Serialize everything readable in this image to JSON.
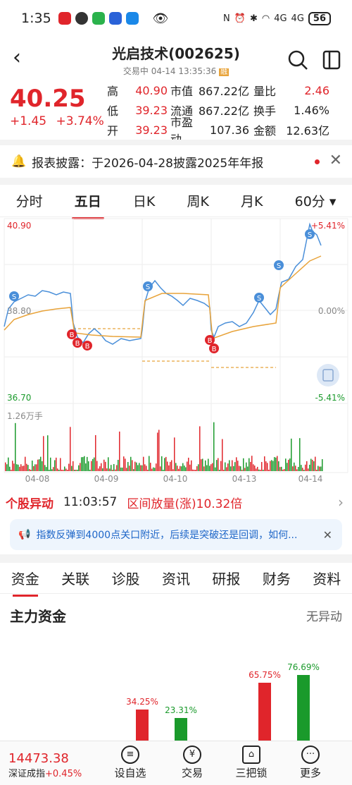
{
  "status": {
    "time": "1:35",
    "battery": "56",
    "net1": "4G",
    "net2": "4G"
  },
  "header": {
    "title": "光启技术(002625)",
    "subtitle": "交易中 04-14 13:35:36",
    "badge": "融"
  },
  "quote": {
    "price": "40.25",
    "change": "+1.45",
    "change_pct": "+3.74%",
    "rows": [
      {
        "l1": "高",
        "v1": "40.90",
        "l2": "市值",
        "v2": "867.22亿",
        "l3": "量比",
        "v3": "2.46"
      },
      {
        "l1": "低",
        "v1": "39.23",
        "l2": "流通",
        "v2": "867.22亿",
        "l3": "换手",
        "v3": "1.46%"
      },
      {
        "l1": "开",
        "v1": "39.23",
        "l2": "市盈动",
        "v2": "107.36",
        "l3": "金额",
        "v3": "12.63亿"
      }
    ]
  },
  "notice": {
    "text": "报表披露：于2026-04-28披露2025年年报"
  },
  "period_tabs": [
    "分时",
    "五日",
    "日K",
    "周K",
    "月K",
    "60分"
  ],
  "chart_labels": {
    "top_left": "40.90",
    "mid_left": "38.80",
    "bottom_left": "36.70",
    "top_right": "+5.41%",
    "mid_right": "0.00%",
    "bottom_right": "-5.41%",
    "volume": "1.26万手",
    "dates": [
      "04-08",
      "04-09",
      "04-10",
      "04-13",
      "04-14"
    ]
  },
  "alert": {
    "label": "个股异动",
    "time": "11:03:57",
    "text": "区间放量(涨)10.32倍"
  },
  "news": {
    "text": "指数反弹到4000点关口附近，后续是突破还是回调，如何..."
  },
  "bottom_tabs": [
    "资金",
    "关联",
    "诊股",
    "资讯",
    "研报",
    "财务",
    "资料"
  ],
  "section": {
    "title": "主力资金",
    "right": "无异动"
  },
  "funds_values": [
    "34.25%",
    "23.31%",
    "65.75%",
    "76.69%"
  ],
  "bottom_nav": {
    "index_value": "14473.38",
    "index_name": "深证成指",
    "index_chg": "+0.45%",
    "items": [
      "设自选",
      "交易",
      "三把锁",
      "更多"
    ]
  },
  "colors": {
    "up": "#e0252b",
    "down": "#1a9a2b",
    "line": "#4a8fd9",
    "avg": "#e8a33a"
  }
}
